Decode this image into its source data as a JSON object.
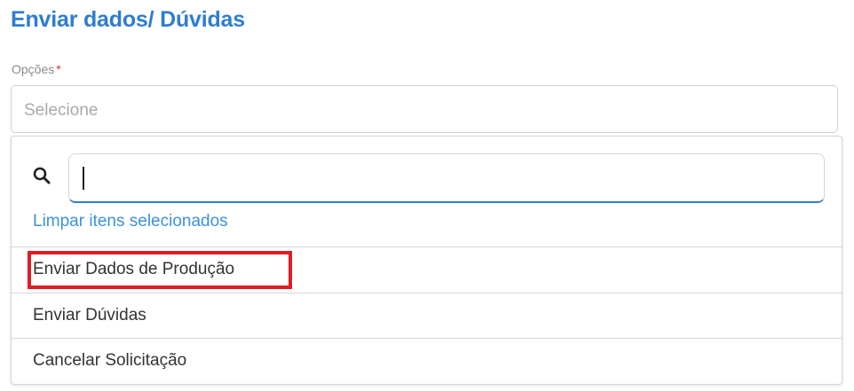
{
  "page": {
    "title": "Enviar dados/ Dúvidas"
  },
  "field": {
    "label": "Opções",
    "required_mark": "*",
    "placeholder": "Selecione"
  },
  "dropdown": {
    "search_value": "",
    "clear_label": "Limpar itens selecionados",
    "options": [
      {
        "label": "Enviar Dados de Produção",
        "highlighted": true
      },
      {
        "label": "Enviar Dúvidas",
        "highlighted": false
      },
      {
        "label": "Cancelar Solicitação",
        "highlighted": false
      }
    ]
  },
  "icons": {
    "search": "search-icon"
  },
  "colors": {
    "title": "#2e7dd1",
    "link": "#3a92db",
    "required": "#d0342c",
    "highlight": "#e01b24",
    "input_focus": "#2e7dd1"
  }
}
